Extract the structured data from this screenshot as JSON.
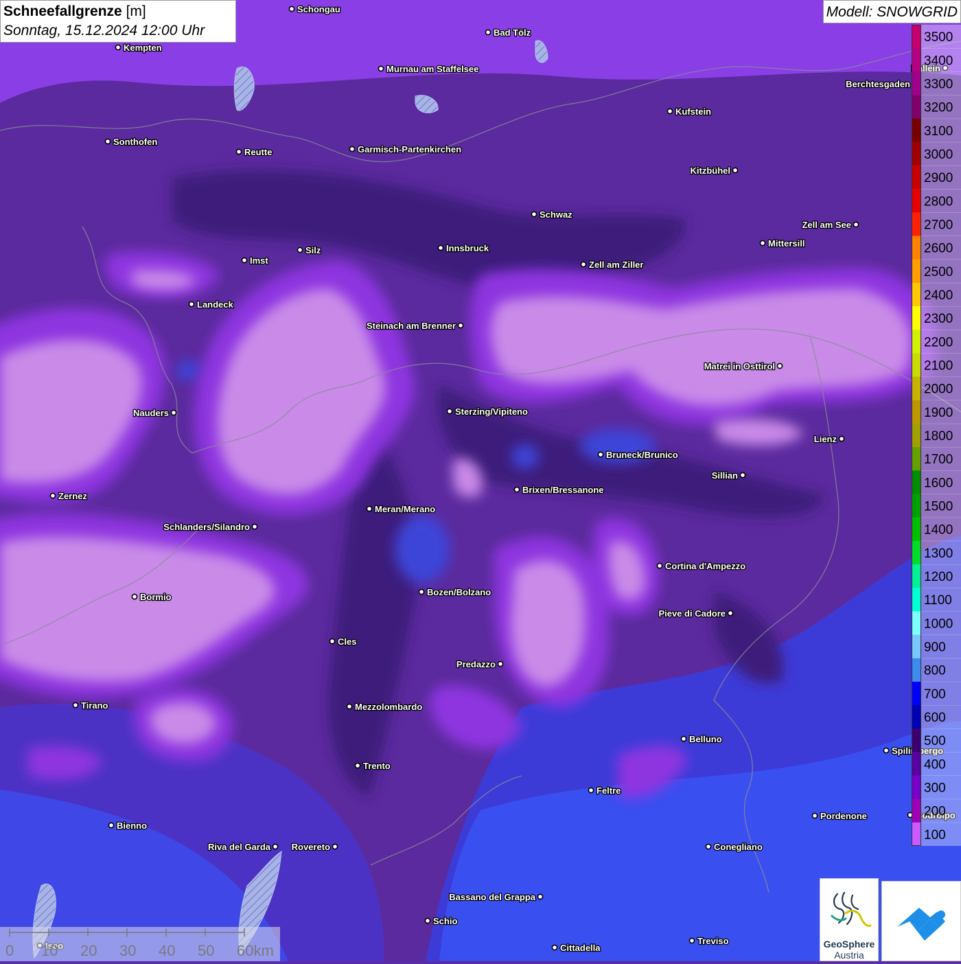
{
  "title": {
    "parameter": "Schneefallgrenze",
    "unit": "[m]",
    "datetime": "Sonntag, 15.12.2024 12:00 Uhr"
  },
  "model": {
    "label": "Modell: SNOWGRID"
  },
  "legend": {
    "levels": [
      {
        "value": "3500",
        "color": "#c8006e"
      },
      {
        "value": "3400",
        "color": "#b40082"
      },
      {
        "value": "3300",
        "color": "#a0008c"
      },
      {
        "value": "3200",
        "color": "#82006e"
      },
      {
        "value": "3100",
        "color": "#780000"
      },
      {
        "value": "3000",
        "color": "#a00000"
      },
      {
        "value": "2900",
        "color": "#c80000"
      },
      {
        "value": "2800",
        "color": "#e60000"
      },
      {
        "value": "2700",
        "color": "#ff2000"
      },
      {
        "value": "2600",
        "color": "#ff8200"
      },
      {
        "value": "2500",
        "color": "#ffa000"
      },
      {
        "value": "2400",
        "color": "#ffc800"
      },
      {
        "value": "2300",
        "color": "#ffff00"
      },
      {
        "value": "2200",
        "color": "#d2f000"
      },
      {
        "value": "2100",
        "color": "#c8dc00"
      },
      {
        "value": "2000",
        "color": "#c8b400"
      },
      {
        "value": "1900",
        "color": "#be9600"
      },
      {
        "value": "1800",
        "color": "#a0a000"
      },
      {
        "value": "1700",
        "color": "#64a000"
      },
      {
        "value": "1600",
        "color": "#008c00"
      },
      {
        "value": "1500",
        "color": "#00a000"
      },
      {
        "value": "1400",
        "color": "#00be00"
      },
      {
        "value": "1300",
        "color": "#00dc28"
      },
      {
        "value": "1200",
        "color": "#00f096"
      },
      {
        "value": "1100",
        "color": "#00ffd2"
      },
      {
        "value": "1000",
        "color": "#7dffff"
      },
      {
        "value": "900",
        "color": "#78c8ff"
      },
      {
        "value": "800",
        "color": "#3c8cf0"
      },
      {
        "value": "700",
        "color": "#0000ff"
      },
      {
        "value": "600",
        "color": "#0000b4"
      },
      {
        "value": "500",
        "color": "#3c006e"
      },
      {
        "value": "400",
        "color": "#5a00a0"
      },
      {
        "value": "300",
        "color": "#7800c8"
      },
      {
        "value": "200",
        "color": "#a000b4"
      },
      {
        "value": "100",
        "color": "#c85aff"
      }
    ]
  },
  "places": [
    {
      "name": "Schongau",
      "side": "right"
    },
    {
      "name": "Kempten",
      "side": "right"
    },
    {
      "name": "Bad Tölz",
      "side": "right"
    },
    {
      "name": "Murnau am Staffelsee",
      "side": "right"
    },
    {
      "name": "Hallein",
      "side": "left"
    },
    {
      "name": "Berchtesgaden",
      "side": "left"
    },
    {
      "name": "Kufstein",
      "side": "right"
    },
    {
      "name": "Sonthofen",
      "side": "right"
    },
    {
      "name": "Reutte",
      "side": "right"
    },
    {
      "name": "Garmisch-Partenkirchen",
      "side": "right"
    },
    {
      "name": "Kitzbühel",
      "side": "left"
    },
    {
      "name": "Schwaz",
      "side": "right"
    },
    {
      "name": "Zell am See",
      "side": "left"
    },
    {
      "name": "Mittersill",
      "side": "right"
    },
    {
      "name": "Innsbruck",
      "side": "right"
    },
    {
      "name": "Silz",
      "side": "right"
    },
    {
      "name": "Imst",
      "side": "right"
    },
    {
      "name": "Zell am Ziller",
      "side": "right"
    },
    {
      "name": "Landeck",
      "side": "right"
    },
    {
      "name": "Steinach am Brenner",
      "side": "left"
    },
    {
      "name": "Matrei in Osttirol",
      "side": "left"
    },
    {
      "name": "Nauders",
      "side": "left"
    },
    {
      "name": "Sterzing/Vipiteno",
      "side": "right"
    },
    {
      "name": "Lienz",
      "side": "left"
    },
    {
      "name": "Bruneck/Brunico",
      "side": "right"
    },
    {
      "name": "Sillian",
      "side": "left"
    },
    {
      "name": "Zernez",
      "side": "right"
    },
    {
      "name": "Brixen/Bressanone",
      "side": "right"
    },
    {
      "name": "Meran/Merano",
      "side": "right"
    },
    {
      "name": "Schlanders/Silandro",
      "side": "left"
    },
    {
      "name": "Cortina d'Ampezzo",
      "side": "right"
    },
    {
      "name": "Bozen/Bolzano",
      "side": "right"
    },
    {
      "name": "Bormio",
      "side": "right"
    },
    {
      "name": "Pieve di Cadore",
      "side": "left"
    },
    {
      "name": "Cles",
      "side": "right"
    },
    {
      "name": "Predazzo",
      "side": "left"
    },
    {
      "name": "Tirano",
      "side": "right"
    },
    {
      "name": "Mezzolombardo",
      "side": "right"
    },
    {
      "name": "Belluno",
      "side": "right"
    },
    {
      "name": "Spilimbergo",
      "side": "right"
    },
    {
      "name": "Trento",
      "side": "right"
    },
    {
      "name": "Feltre",
      "side": "right"
    },
    {
      "name": "Pordenone",
      "side": "right"
    },
    {
      "name": "Codroipo",
      "side": "right"
    },
    {
      "name": "Bienno",
      "side": "right"
    },
    {
      "name": "Riva del Garda",
      "side": "left"
    },
    {
      "name": "Rovereto",
      "side": "left"
    },
    {
      "name": "Conegliano",
      "side": "right"
    },
    {
      "name": "Bassano del Grappa",
      "side": "left"
    },
    {
      "name": "Schio",
      "side": "right"
    },
    {
      "name": "Treviso",
      "side": "right"
    },
    {
      "name": "Cittadella",
      "side": "right"
    },
    {
      "name": "Iseo",
      "side": "right"
    }
  ],
  "scalebar": {
    "ticks": [
      "0",
      "10",
      "20",
      "30",
      "40",
      "50",
      "60km"
    ]
  },
  "logos": {
    "geosphere_name": "GeoSphere",
    "geosphere_sub": "Austria"
  }
}
